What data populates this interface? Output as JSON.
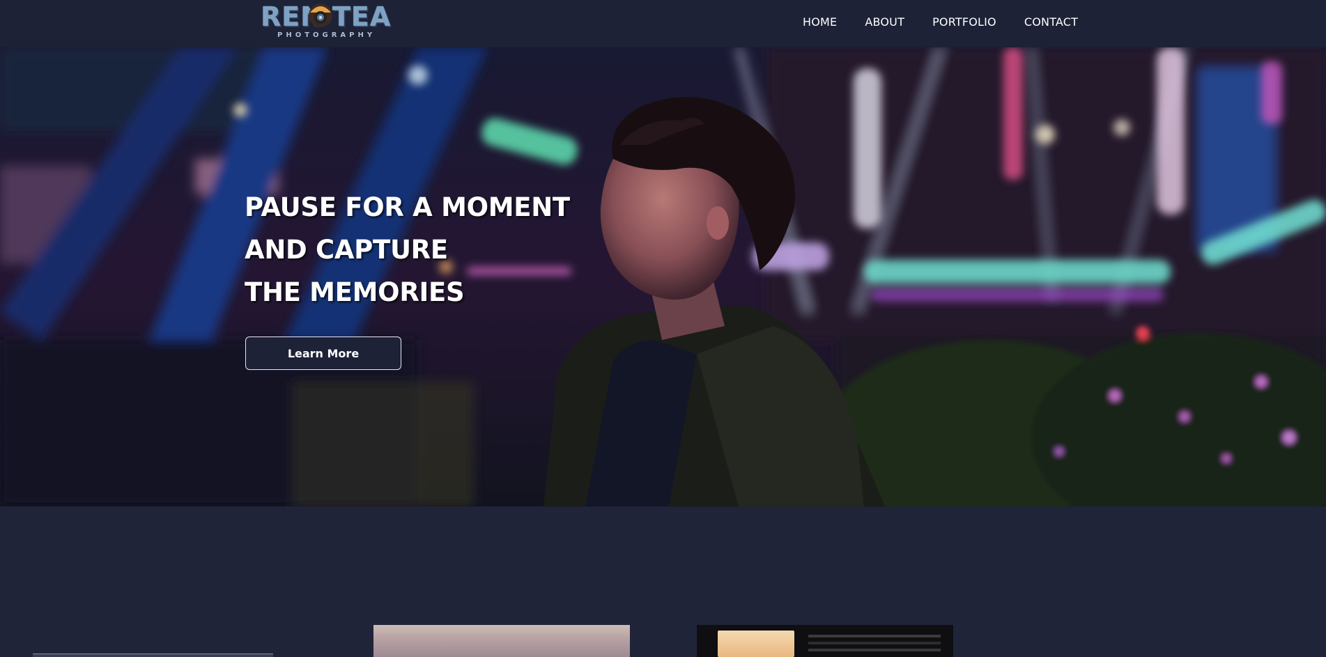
{
  "navbar": {
    "logo": {
      "word_left": "REN",
      "word_right": "TEA",
      "subtitle": "PHOTOGRAPHY",
      "mascot_icon": "camera-mascot-icon"
    },
    "links": [
      {
        "label": "HOME"
      },
      {
        "label": "ABOUT"
      },
      {
        "label": "PORTFOLIO"
      },
      {
        "label": "CONTACT"
      }
    ]
  },
  "hero": {
    "heading_lines": [
      "PAUSE FOR A MOMENT",
      "AND CAPTURE",
      "THE MEMORIES"
    ],
    "cta_label": "Learn More"
  },
  "colors": {
    "nav_bg": "#1d2237",
    "page_bg": "#1e2338",
    "text": "#ffffff",
    "logo_accent": "#7ea2c4"
  }
}
